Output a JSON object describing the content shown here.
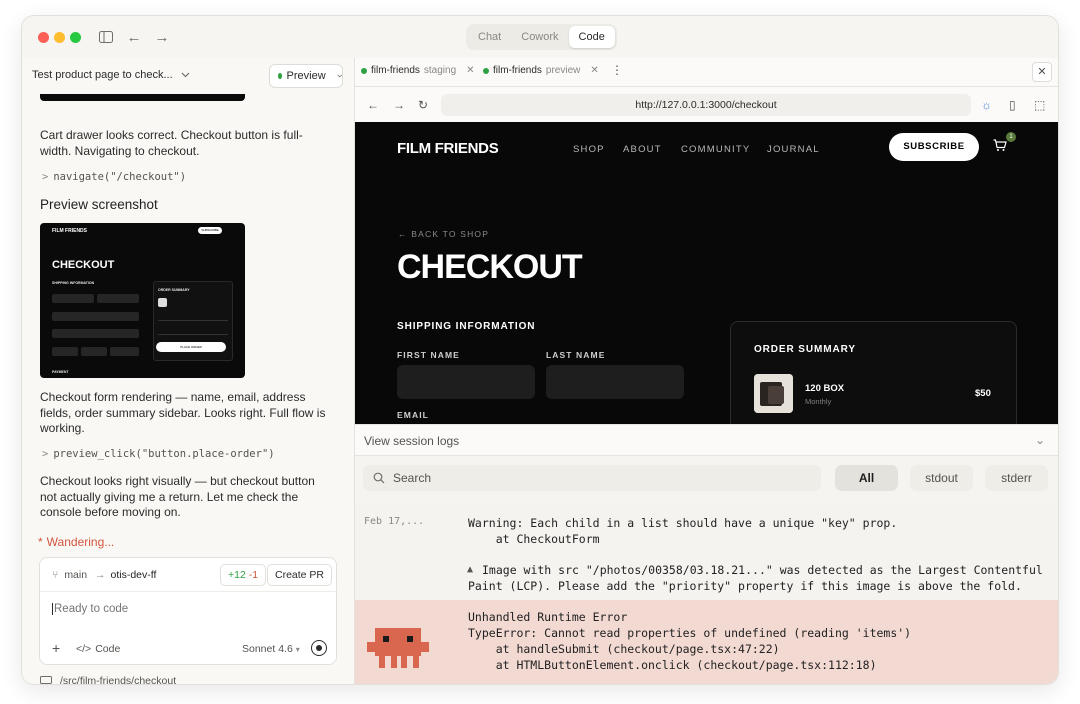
{
  "modes": [
    "Chat",
    "Cowork",
    "Code"
  ],
  "active_mode": "Code",
  "left": {
    "task_title": "Test product page to check...",
    "preview_button": "Preview",
    "messages": [
      "Cart drawer looks correct. Checkout button is full-width. Navigating to checkout.",
      "navigate(\"/checkout\")",
      "Preview screenshot",
      "Checkout form rendering — name, email, address fields, order summary sidebar. Looks right. Full flow is working.",
      "preview_click(\"button.place-order\")",
      "Checkout looks right visually — but checkout button not actually giving me a return. Let me check the console before moving on."
    ],
    "status": "Wandering...",
    "composer": {
      "branch_base": "main",
      "branch_target": "otis-dev-ff",
      "diff_add": "+12",
      "diff_del": "-1",
      "create_pr": "Create PR",
      "placeholder": "Ready to code",
      "mode_label": "Code",
      "model": "Sonnet 4.6"
    },
    "cwd": "/src/film-friends/checkout"
  },
  "thumbnail": {
    "brand": "FILM FRIENDS",
    "subscribe": "SUBSCRIBE",
    "heading": "CHECKOUT",
    "shipping": "SHIPPING INFORMATION",
    "order_summary": "ORDER SUMMARY",
    "place_order": "PLACE ORDER",
    "payment": "PAYMENT"
  },
  "right": {
    "tabs": [
      {
        "name": "film-friends",
        "env": "staging"
      },
      {
        "name": "film-friends",
        "env": "preview"
      }
    ],
    "url": "http://127.0.0.1:3000/checkout",
    "site": {
      "logo": "FILM FRIENDS",
      "nav": [
        "SHOP",
        "ABOUT",
        "COMMUNITY",
        "JOURNAL"
      ],
      "subscribe": "SUBSCRIBE",
      "cart_count": "1",
      "back": "← BACK TO SHOP",
      "heading": "CHECKOUT",
      "shipping": "SHIPPING INFORMATION",
      "first_name": "FIRST NAME",
      "last_name": "LAST NAME",
      "email": "EMAIL",
      "order_summary": "ORDER SUMMARY",
      "product_name": "120 BOX",
      "product_sub": "Monthly",
      "product_price": "$50"
    },
    "logs": {
      "title": "View session logs",
      "search": "Search",
      "filters": [
        "All",
        "stdout",
        "stderr"
      ],
      "active_filter": "All",
      "timestamp": "Feb 17,...",
      "lines": [
        "Warning: Each child in a list should have a unique \"key\" prop.",
        "    at CheckoutForm",
        "Image with src \"/photos/00358/03.18.21...\" was detected as the Largest Contentful",
        "Paint (LCP). Please add the \"priority\" property if this image is above the fold."
      ],
      "error_lines": [
        "Unhandled Runtime Error",
        "TypeError: Cannot read properties of undefined (reading 'items')",
        "    at handleSubmit (checkout/page.tsx:47:22)",
        "    at HTMLButtonElement.onclick (checkout/page.tsx:112:18)"
      ]
    }
  },
  "colors": {
    "accent_red": "#d1553f",
    "green_dot": "#2ea043",
    "error_bg": "#f2d9d2",
    "mascot": "#d9674f"
  }
}
